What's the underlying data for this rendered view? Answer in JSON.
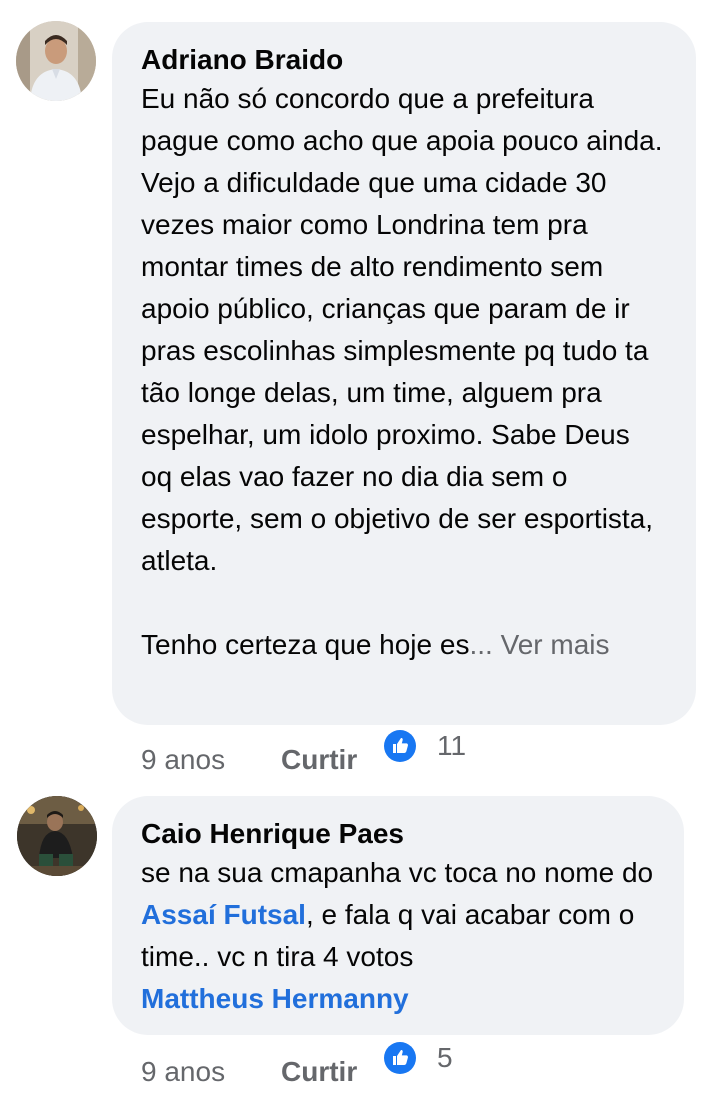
{
  "comments": [
    {
      "author": "Adriano Braido",
      "paragraphs": [
        "Eu não só concordo que a prefeitura pague como acho que apoia pouco ainda. Vejo a dificuldade que uma cidade 30 vezes maior como Londrina tem pra montar times de alto rendimento sem apoio público, crianças que param de ir pras escolinhas simplesmente pq tudo ta tão longe delas, um time, alguem pra espelhar, um idolo proximo. Sabe Deus oq elas vao fazer no dia dia sem o esporte, sem o objetivo de ser esportista, atleta."
      ],
      "truncated_text": "Tenho certeza que hoje es",
      "ellipsis": "...",
      "see_more": "Ver mais",
      "time": "9 anos",
      "like_label": "Curtir",
      "reaction_icon": "thumbs-up-icon",
      "reaction_count": "11"
    },
    {
      "author": "Caio Henrique Paes",
      "text_before_mention": "se na sua cmapanha vc toca no nome do ",
      "mention_1": "Assaí Futsal",
      "text_after_mention": ", e fala q vai acabar com o time.. vc n tira 4 votos",
      "mention_2": "Mattheus Hermanny",
      "time": "9 anos",
      "like_label": "Curtir",
      "reaction_icon": "thumbs-up-icon",
      "reaction_count": "5"
    }
  ],
  "colors": {
    "bubble": "#f0f2f5",
    "text": "#050505",
    "secondary": "#65676b",
    "mention": "#216fdb",
    "like_blue": "#1877f2"
  }
}
